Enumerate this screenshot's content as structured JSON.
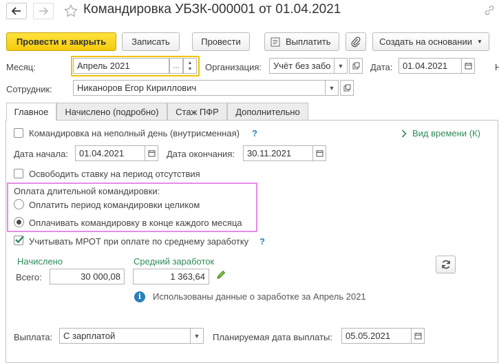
{
  "window": {
    "title": "Командировка УБЗК-000001 от 01.04.2021"
  },
  "toolbar": {
    "post_close": "Провести и закрыть",
    "save": "Записать",
    "post": "Провести",
    "pay": "Выплатить",
    "create_based": "Создать на основании"
  },
  "header": {
    "month_label": "Месяц:",
    "month_value": "Апрель 2021",
    "month_ellipsis": "...",
    "org_label": "Организация:",
    "org_value": "Учёт без забо",
    "date_label": "Дата:",
    "date_value": "01.04.2021",
    "edge_char": "Н",
    "employee_label": "Сотрудник:",
    "employee_value": "Никаноров Егор Кириллович"
  },
  "tabs": [
    "Главное",
    "Начислено (подробно)",
    "Стаж ПФР",
    "Дополнительно"
  ],
  "main": {
    "partial_day_label": "Командировка на неполный день (внутрисменная)",
    "help_mark": "?",
    "time_type_link": "Вид времени (К)",
    "start_label": "Дата начала:",
    "start_value": "01.04.2021",
    "end_label": "Дата окончания:",
    "end_value": "30.11.2021",
    "free_rate_label": "Освободить ставку на период отсутствия",
    "long_trip_title": "Оплата длительной командировки:",
    "radio_whole": "Оплатить период командировки целиком",
    "radio_monthly": "Оплачивать командировку в конце каждого месяца",
    "mrot_label": "Учитывать МРОТ при оплате по среднему заработку",
    "accrued_title": "Начислено",
    "avg_title": "Средний заработок",
    "total_label": "Всего:",
    "total_value": "30 000,08",
    "avg_value": "1 363,64",
    "info_text": "Использованы данные о заработке за Апрель 2021",
    "info_mark": "i",
    "payout_label": "Выплата:",
    "payout_value": "С зарплатой",
    "planned_date_label": "Планируемая дата выплаты:",
    "planned_date_value": "05.05.2021"
  },
  "colors": {
    "accent_yellow": "#f5cb0d",
    "highlight_pink": "#e68be6",
    "green": "#2e8b57",
    "info_blue": "#2980b9"
  }
}
